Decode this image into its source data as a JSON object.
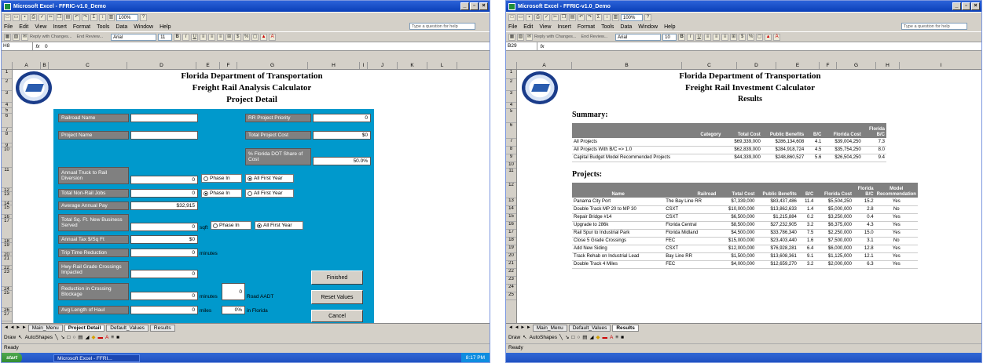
{
  "left": {
    "window_title": "Microsoft Excel - FFRIC-v1.0_Demo",
    "menu": [
      "File",
      "Edit",
      "View",
      "Insert",
      "Format",
      "Tools",
      "Data",
      "Window",
      "Help"
    ],
    "help_placeholder": "Type a question for help",
    "zoom": "100%",
    "font": "Arial",
    "font_size": "11",
    "reply_text": "Reply with Changes...",
    "end_review": "End Review...",
    "name_box": "H8",
    "fx": "fx",
    "formula_value": "0",
    "columns": [
      "A",
      "B",
      "C",
      "D",
      "E",
      "F",
      "G",
      "H",
      "I",
      "J",
      "K",
      "L"
    ],
    "rows": [
      "1",
      "2",
      "3",
      "4",
      "5",
      "6",
      "7",
      "8",
      "9",
      "10",
      "11",
      "12",
      "13",
      "14",
      "15",
      "16",
      "17",
      "18",
      "19",
      "20",
      "21",
      "22",
      "23",
      "24",
      "25",
      "26",
      "27"
    ],
    "title1": "Florida Department of Transportation",
    "title2": "Freight Rail Analysis Calculator",
    "title3": "Project Detail",
    "fields": {
      "railroad_name": "Railroad Name",
      "project_name": "Project Name",
      "truck_diversion": "Annual Truck to Rail Diversion",
      "truck_diversion_value": "0",
      "non_rail_jobs": "Total Non-Rail Jobs",
      "non_rail_jobs_value": "0",
      "avg_pay": "Average Annual Pay",
      "avg_pay_value": "$32,915",
      "sqft_served": "Total Sq. Ft. New Business Served",
      "sqft_value": "0",
      "sqft_unit": "sqft",
      "tax": "Annual Tax $/Sq Ft",
      "tax_value": "$0",
      "trip_time": "Trip Time Reduction",
      "trip_time_value": "0",
      "trip_time_unit": "minutes",
      "crossings": "Hwy-Rail Grade Crossings Impacted",
      "crossings_value": "0",
      "blockage": "Reduction in Crossing Blockage",
      "blockage_value": "0",
      "blockage_unit": "minutes",
      "aadt_value": "0",
      "aadt_label": "Road AADT",
      "haul": "Avg Length of Haul",
      "haul_value": "0",
      "haul_unit": "miles",
      "haul_pct": "0%",
      "haul_pct_label": "in Florida",
      "rr_priority": "RR Project Priority",
      "rr_priority_value": "0",
      "total_cost": "Total Project Cost",
      "total_cost_value": "$0",
      "fdot_share": "% Florida DOT Share of Cost",
      "fdot_share_value": "50.0%",
      "phase_in": "Phase In",
      "all_first_year": "All First Year"
    },
    "buttons": {
      "finished": "Finished",
      "reset": "Reset Values",
      "cancel": "Cancel"
    },
    "sheet_tabs": [
      "Main_Menu",
      "Project Detail",
      "Default_Values",
      "Results"
    ],
    "draw": "Draw",
    "autoshapes": "AutoShapes",
    "status": "Ready",
    "start": "start",
    "task_item": "Microsoft Excel - FFRI...",
    "clock": "8:17 PM"
  },
  "right": {
    "window_title": "Microsoft Excel - FFRIC-v1.0_Demo",
    "menu": [
      "File",
      "Edit",
      "View",
      "Insert",
      "Format",
      "Tools",
      "Data",
      "Window",
      "Help"
    ],
    "help_placeholder": "Type a question for help",
    "zoom": "100%",
    "font": "Arial",
    "font_size": "10",
    "reply_text": "Reply with Changes...",
    "end_review": "End Review...",
    "name_box": "B29",
    "fx": "fx",
    "columns": [
      "A",
      "B",
      "C",
      "D",
      "E",
      "F",
      "G",
      "H",
      "I"
    ],
    "rows": [
      "1",
      "2",
      "3",
      "4",
      "5",
      "6",
      "7",
      "8",
      "9",
      "10",
      "11",
      "12",
      "13",
      "14",
      "15",
      "16",
      "17",
      "18",
      "19",
      "20",
      "21",
      "22",
      "23",
      "24",
      "25"
    ],
    "title1": "Florida Department of Transportation",
    "title2": "Freight Rail Investment Calculator",
    "title3": "Results",
    "summary_title": "Summary:",
    "summary_headers": [
      "Category",
      "Total Cost",
      "Public Benefits",
      "B/C",
      "Florida Cost",
      "Florida B/C"
    ],
    "summary_rows": [
      [
        "All Projects",
        "$69,339,000",
        "$286,134,608",
        "4.1",
        "$39,004,250",
        "7.3"
      ],
      [
        "All Projects With B/C => 1.0",
        "$62,839,000",
        "$284,918,724",
        "4.5",
        "$35,754,250",
        "8.0"
      ],
      [
        "Capital Budget Model Recommended Projects",
        "$44,339,000",
        "$248,860,527",
        "5.6",
        "$26,504,250",
        "9.4"
      ]
    ],
    "projects_title": "Projects:",
    "project_headers": [
      "Name",
      "Railroad",
      "Total Cost",
      "Public Benefits",
      "B/C",
      "Florida Cost",
      "Florida B/C",
      "Model Recommendation"
    ],
    "project_rows": [
      [
        "Panama City Port",
        "The Bay Line RR",
        "$7,339,000",
        "$83,437,486",
        "11.4",
        "$5,504,250",
        "15.2",
        "Yes"
      ],
      [
        "Double Track MP 20 to MP 30",
        "CSXT",
        "$10,000,000",
        "$13,862,633",
        "1.4",
        "$5,000,000",
        "2.8",
        "No"
      ],
      [
        "Repair Bridge #14",
        "CSXT",
        "$6,500,000",
        "$1,215,884",
        "0.2",
        "$3,250,000",
        "0.4",
        "Yes"
      ],
      [
        "Upgrade to 286k",
        "Florida Central",
        "$8,500,000",
        "$27,232,905",
        "3.2",
        "$6,375,000",
        "4.3",
        "Yes"
      ],
      [
        "Rail Spur to Industrial Park",
        "Florida Midland",
        "$4,500,000",
        "$33,786,340",
        "7.5",
        "$2,250,000",
        "15.0",
        "Yes"
      ],
      [
        "Close 5 Grade Crossings",
        "FEC",
        "$15,000,000",
        "$23,403,440",
        "1.6",
        "$7,500,000",
        "3.1",
        "No"
      ],
      [
        "Add New Siding",
        "CSXT",
        "$12,000,000",
        "$76,928,281",
        "6.4",
        "$6,000,000",
        "12.8",
        "Yes"
      ],
      [
        "Track Rehab on Industrial Lead",
        "Bay Line RR",
        "$1,500,000",
        "$13,608,361",
        "9.1",
        "$1,125,000",
        "12.1",
        "Yes"
      ],
      [
        "Double Track 4 Miles",
        "FEC",
        "$4,000,000",
        "$12,659,270",
        "3.2",
        "$2,000,000",
        "6.3",
        "Yes"
      ]
    ],
    "sheet_tabs": [
      "Main_Menu",
      "Default_Values",
      "Results"
    ],
    "draw": "Draw",
    "autoshapes": "AutoShapes",
    "status": "Ready"
  }
}
